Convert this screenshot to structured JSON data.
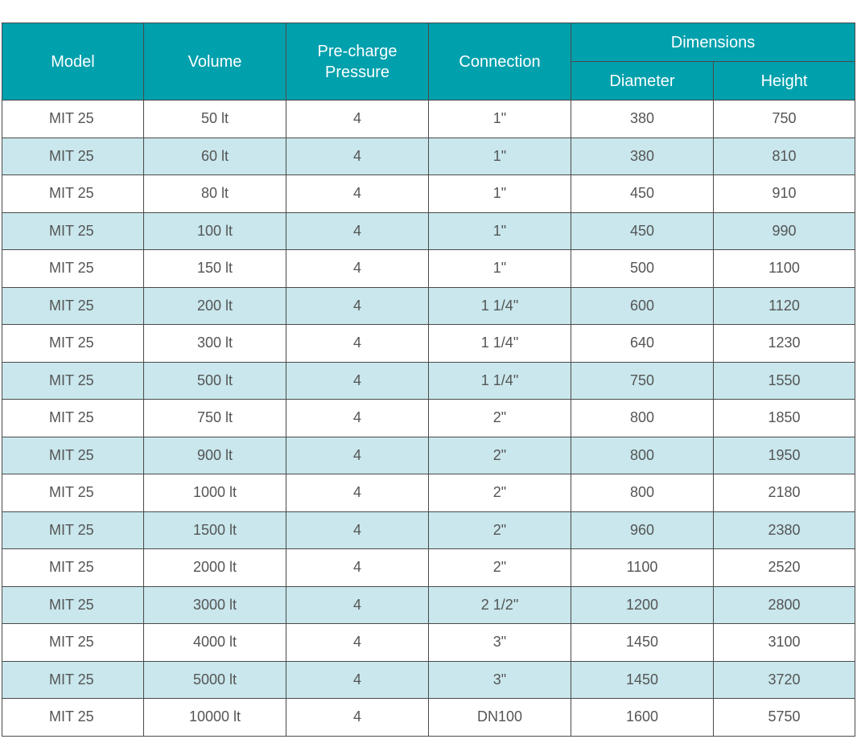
{
  "headers": {
    "model": "Model",
    "volume": "Volume",
    "precharge_line1": "Pre-charge",
    "precharge_line2": "Pressure",
    "connection": "Connection",
    "dimensions": "Dimensions",
    "diameter": "Diameter",
    "height": "Height"
  },
  "colors": {
    "header_bg": "#00a0ad",
    "alt_row_bg": "#c9e7ec"
  },
  "rows": [
    [
      "MIT 25",
      "50 lt",
      "4",
      "1\"",
      "380",
      "750"
    ],
    [
      "MIT 25",
      "60 lt",
      "4",
      "1\"",
      "380",
      "810"
    ],
    [
      "MIT 25",
      "80 lt",
      "4",
      "1\"",
      "450",
      "910"
    ],
    [
      "MIT 25",
      "100 lt",
      "4",
      "1\"",
      "450",
      "990"
    ],
    [
      "MIT 25",
      "150 lt",
      "4",
      "1\"",
      "500",
      "1100"
    ],
    [
      "MIT 25",
      "200 lt",
      "4",
      "1 1/4\"",
      "600",
      "1120"
    ],
    [
      "MIT 25",
      "300 lt",
      "4",
      "1 1/4\"",
      "640",
      "1230"
    ],
    [
      "MIT 25",
      "500 lt",
      "4",
      "1 1/4\"",
      "750",
      "1550"
    ],
    [
      "MIT 25",
      "750 lt",
      "4",
      "2\"",
      "800",
      "1850"
    ],
    [
      "MIT 25",
      "900 lt",
      "4",
      "2\"",
      "800",
      "1950"
    ],
    [
      "MIT 25",
      "1000 lt",
      "4",
      "2\"",
      "800",
      "2180"
    ],
    [
      "MIT 25",
      "1500 lt",
      "4",
      "2\"",
      "960",
      "2380"
    ],
    [
      "MIT 25",
      "2000 lt",
      "4",
      "2\"",
      "1100",
      "2520"
    ],
    [
      "MIT 25",
      "3000 lt",
      "4",
      "2 1/2\"",
      "1200",
      "2800"
    ],
    [
      "MIT 25",
      "4000 lt",
      "4",
      "3\"",
      "1450",
      "3100"
    ],
    [
      "MIT 25",
      "5000 lt",
      "4",
      "3\"",
      "1450",
      "3720"
    ],
    [
      "MIT 25",
      "10000 lt",
      "4",
      "DN100",
      "1600",
      "5750"
    ]
  ]
}
